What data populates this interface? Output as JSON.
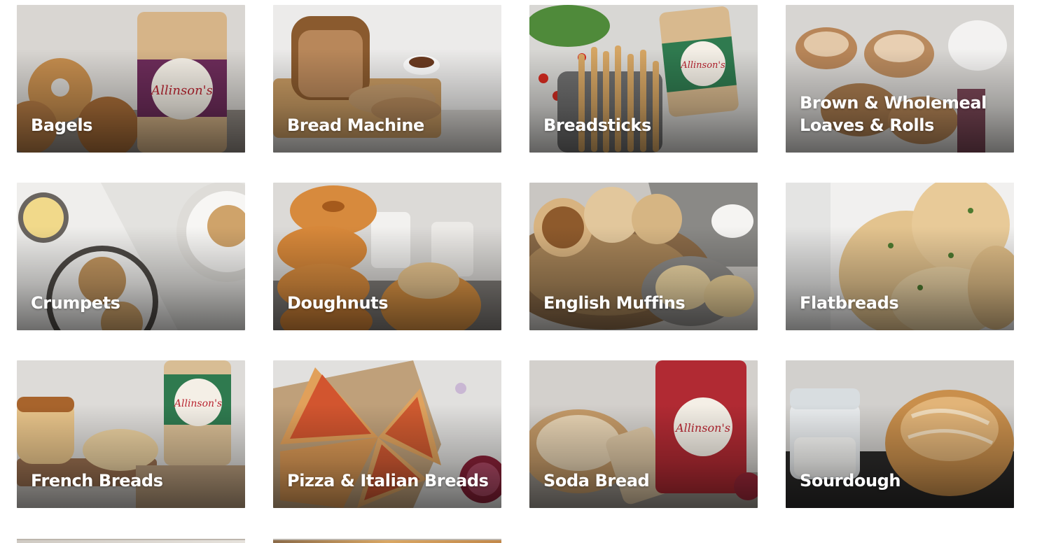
{
  "categories": [
    {
      "label": "Bagels"
    },
    {
      "label": "Bread Machine"
    },
    {
      "label": "Breadsticks"
    },
    {
      "label": "Brown & Wholemeal Loaves & Rolls"
    },
    {
      "label": "Crumpets"
    },
    {
      "label": "Doughnuts"
    },
    {
      "label": "English Muffins"
    },
    {
      "label": "Flatbreads"
    },
    {
      "label": "French Breads"
    },
    {
      "label": "Pizza & Italian Breads"
    },
    {
      "label": "Soda Bread"
    },
    {
      "label": "Sourdough"
    }
  ],
  "brand": {
    "logo_text": "Allinson's",
    "flour_red": "#b8232f",
    "purple_band": "#6d2c5a",
    "green_band": "#2f7a4f"
  }
}
